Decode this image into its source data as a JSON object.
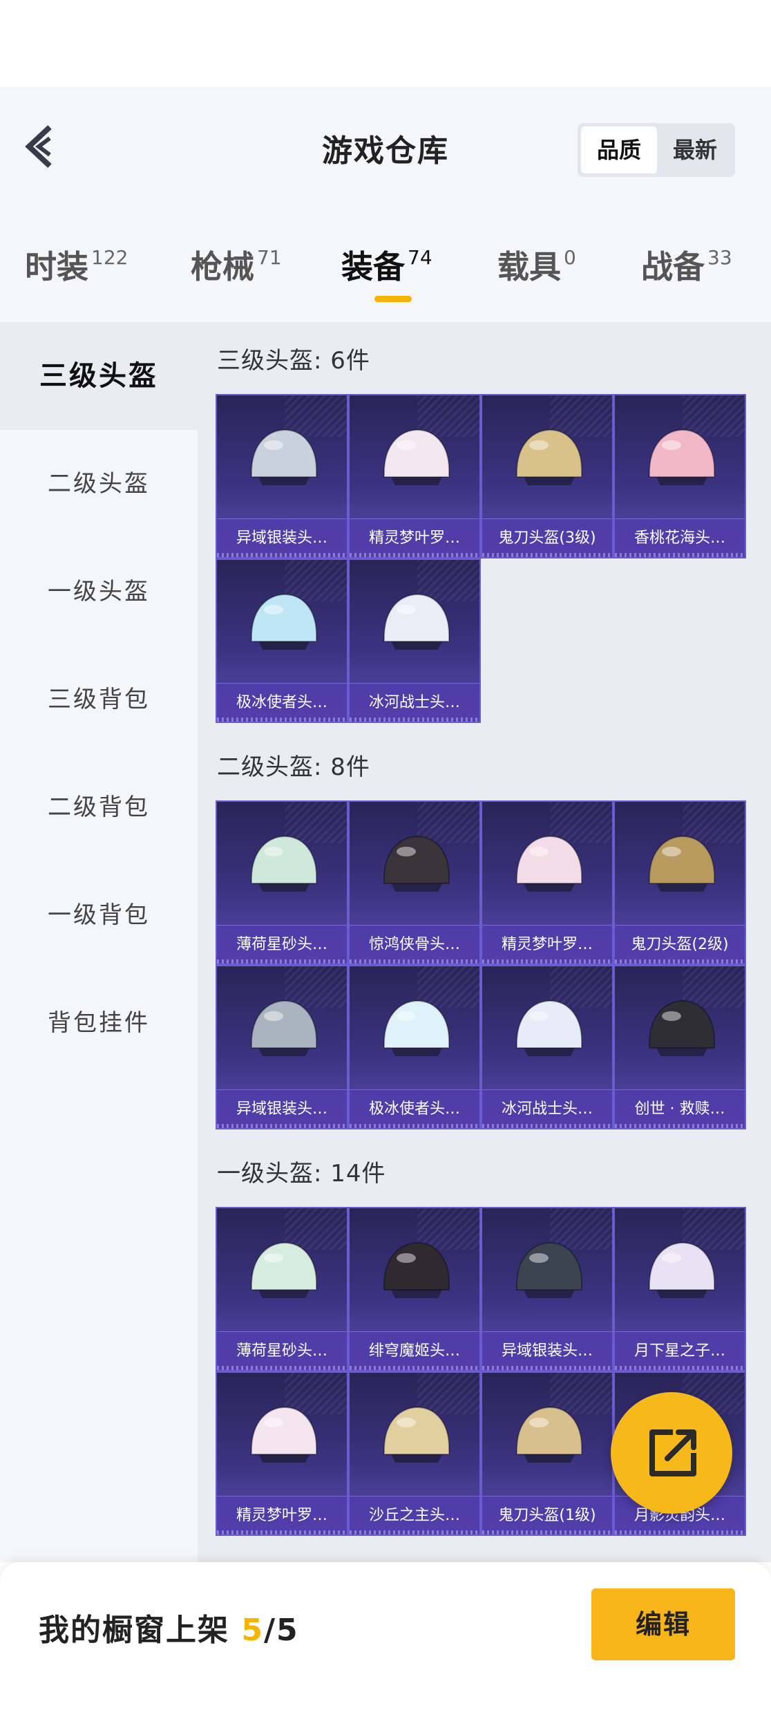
{
  "header": {
    "title": "游戏仓库",
    "sort_options": [
      {
        "label": "品质",
        "active": true
      },
      {
        "label": "最新",
        "active": false
      }
    ]
  },
  "tabs": [
    {
      "label": "时装",
      "count": "122",
      "active": false
    },
    {
      "label": "枪械",
      "count": "71",
      "active": false
    },
    {
      "label": "装备",
      "count": "74",
      "active": true
    },
    {
      "label": "载具",
      "count": "0",
      "active": false
    },
    {
      "label": "战备",
      "count": "33",
      "active": false
    }
  ],
  "sidebar": {
    "items": [
      {
        "label": "三级头盔",
        "active": true
      },
      {
        "label": "二级头盔",
        "active": false
      },
      {
        "label": "一级头盔",
        "active": false
      },
      {
        "label": "三级背包",
        "active": false
      },
      {
        "label": "二级背包",
        "active": false
      },
      {
        "label": "一级背包",
        "active": false
      },
      {
        "label": "背包挂件",
        "active": false
      }
    ]
  },
  "sections": [
    {
      "title": "三级头盔: 6件",
      "items": [
        {
          "name": "异域银装头…",
          "icon": "helmet-icon",
          "color": "#c9d2dc"
        },
        {
          "name": "精灵梦叶罗…",
          "icon": "helmet-icon",
          "color": "#f3e8ef"
        },
        {
          "name": "鬼刀头盔(3级)",
          "icon": "helmet-icon",
          "color": "#d8c28a"
        },
        {
          "name": "香桃花海头…",
          "icon": "helmet-icon",
          "color": "#f2b8c8"
        },
        {
          "name": "极冰使者头…",
          "icon": "helmet-icon",
          "color": "#bfe6f4"
        },
        {
          "name": "冰河战士头…",
          "icon": "helmet-icon",
          "color": "#e9eef6"
        }
      ]
    },
    {
      "title": "二级头盔: 8件",
      "items": [
        {
          "name": "薄荷星砂头…",
          "icon": "helmet-icon",
          "color": "#cfe8dc"
        },
        {
          "name": "惊鸿侠骨头…",
          "icon": "helmet-icon",
          "color": "#3a3438"
        },
        {
          "name": "精灵梦叶罗…",
          "icon": "helmet-icon",
          "color": "#f2dde6"
        },
        {
          "name": "鬼刀头盔(2级)",
          "icon": "helmet-icon",
          "color": "#b89a5e"
        },
        {
          "name": "异域银装头…",
          "icon": "helmet-icon",
          "color": "#aab4c0"
        },
        {
          "name": "极冰使者头…",
          "icon": "helmet-icon",
          "color": "#dff2fa"
        },
        {
          "name": "冰河战士头…",
          "icon": "helmet-icon",
          "color": "#e6edf8"
        },
        {
          "name": "创世 · 救赎…",
          "icon": "helmet-icon",
          "color": "#2e2e34"
        }
      ]
    },
    {
      "title": "一级头盔: 14件",
      "items": [
        {
          "name": "薄荷星砂头…",
          "icon": "helmet-icon",
          "color": "#d6ecdf"
        },
        {
          "name": "绯穹魔姬头…",
          "icon": "helmet-icon",
          "color": "#2f2a30"
        },
        {
          "name": "异域银装头…",
          "icon": "helmet-icon",
          "color": "#3c4450"
        },
        {
          "name": "月下星之子…",
          "icon": "helmet-icon",
          "color": "#e8e2f4"
        },
        {
          "name": "精灵梦叶罗…",
          "icon": "helmet-icon",
          "color": "#f4e6ee"
        },
        {
          "name": "沙丘之主头…",
          "icon": "helmet-icon",
          "color": "#e2cfa0"
        },
        {
          "name": "鬼刀头盔(1级)",
          "icon": "helmet-icon",
          "color": "#d7c08e"
        },
        {
          "name": "月影灵韵头…",
          "icon": "helmet-icon",
          "color": "#c9d0e8"
        }
      ]
    }
  ],
  "bottom": {
    "showcase_label": "我的橱窗上架",
    "current": "5",
    "total": "/5",
    "edit_label": "编辑"
  },
  "colors": {
    "accent": "#f6b400",
    "card_bg": "#3b3380",
    "card_border": "#6b5cd0"
  }
}
